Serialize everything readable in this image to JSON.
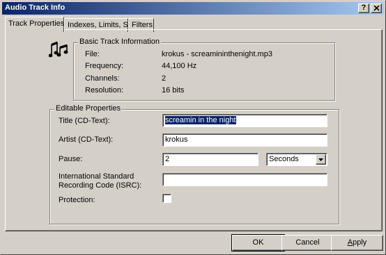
{
  "window": {
    "title": "Audio Track Info",
    "help_button": "?",
    "close_button": "X"
  },
  "tabs": [
    {
      "label": "Track Properties",
      "active": true
    },
    {
      "label": "Indexes, Limits, Split",
      "active": false
    },
    {
      "label": "Filters",
      "active": false
    }
  ],
  "basic_info": {
    "heading": "Basic Track Information",
    "icon": "music-notes-icon",
    "rows": [
      {
        "label": "File:",
        "value": "krokus - screamininthenight.mp3"
      },
      {
        "label": "Frequency:",
        "value": "44,100 Hz"
      },
      {
        "label": "Channels:",
        "value": "2"
      },
      {
        "label": "Resolution:",
        "value": "16 bits"
      }
    ]
  },
  "editable": {
    "heading": "Editable Properties",
    "title_label": "Title (CD-Text):",
    "title_value": "screamin in the night",
    "artist_label": "Artist (CD-Text):",
    "artist_value": "krokus",
    "pause_label": "Pause:",
    "pause_value": "2",
    "pause_unit": "Seconds",
    "isrc_label_line1": "International Standard",
    "isrc_label_line2": "Recording Code (ISRC):",
    "isrc_value": "",
    "protection_label": "Protection:",
    "protection_checked": false
  },
  "buttons": {
    "ok": "OK",
    "cancel": "Cancel",
    "apply_first": "A",
    "apply_rest": "pply"
  },
  "colors": {
    "face": "#d4d0c8",
    "title_start": "#0a246a",
    "title_end": "#a6caf0",
    "selection": "#0a246a"
  }
}
